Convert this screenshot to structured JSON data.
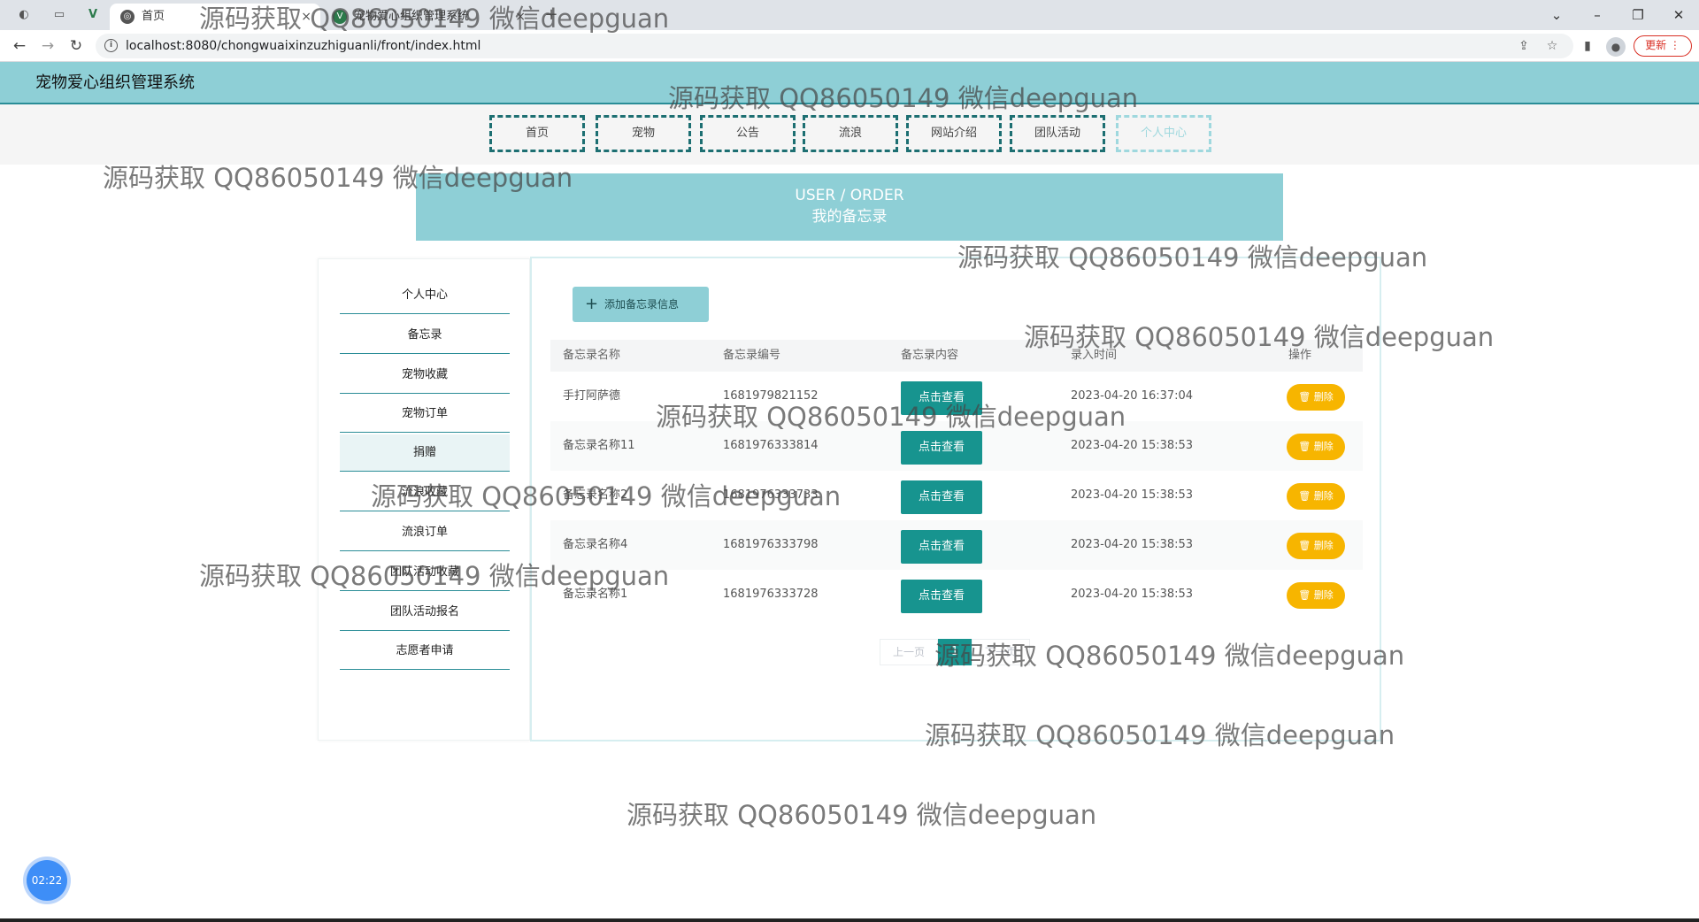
{
  "browser": {
    "tabs": [
      {
        "label": "首页"
      },
      {
        "label": "宠物爱心组织管理系统"
      }
    ],
    "new_tab": "+",
    "url": "localhost:8080/chongwuaixinzuzhiguanli/front/index.html",
    "update_label": "更新"
  },
  "site": {
    "title": "宠物爱心组织管理系统",
    "nav": [
      "首页",
      "宠物",
      "公告",
      "流浪",
      "网站介绍",
      "团队活动",
      "个人中心"
    ]
  },
  "banner": {
    "line1": "USER / ORDER",
    "line2": "我的备忘录"
  },
  "sidebar": {
    "items": [
      "个人中心",
      "备忘录",
      "宠物收藏",
      "宠物订单",
      "捐赠",
      "流浪收藏",
      "流浪订单",
      "团队活动收藏",
      "团队活动报名",
      "志愿者申请"
    ]
  },
  "main": {
    "add_button": "添加备忘录信息",
    "columns": [
      "备忘录名称",
      "备忘录编号",
      "备忘录内容",
      "录入时间",
      "操作"
    ],
    "rows": [
      {
        "name": "手打阿萨德",
        "code": "1681979821152",
        "view": "点击查看",
        "time": "2023-04-20 16:37:04",
        "delete": "删除"
      },
      {
        "name": "备忘录名称11",
        "code": "1681976333814",
        "view": "点击查看",
        "time": "2023-04-20 15:38:53",
        "delete": "删除"
      },
      {
        "name": "备忘录名称2",
        "code": "1681976333733",
        "view": "点击查看",
        "time": "2023-04-20 15:38:53",
        "delete": "删除"
      },
      {
        "name": "备忘录名称4",
        "code": "1681976333798",
        "view": "点击查看",
        "time": "2023-04-20 15:38:53",
        "delete": "删除"
      },
      {
        "name": "备忘录名称1",
        "code": "1681976333728",
        "view": "点击查看",
        "time": "2023-04-20 15:38:53",
        "delete": "删除"
      }
    ],
    "pager": {
      "prev": "上一页",
      "current": "1",
      "next": "下一页"
    }
  },
  "watermark": "源码获取 QQ86050149 微信deepguan",
  "timer": "02:22"
}
